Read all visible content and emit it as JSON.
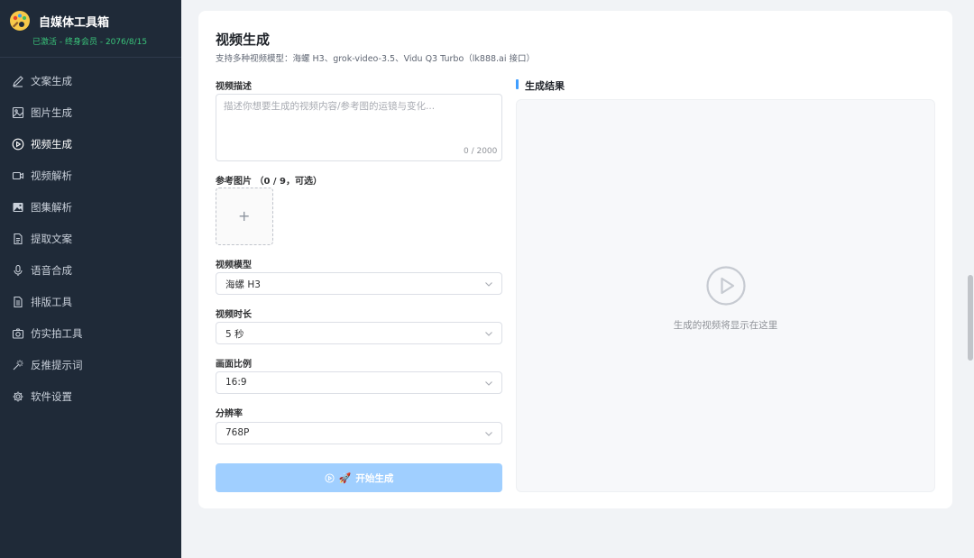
{
  "app": {
    "name": "自媒体工具箱",
    "status": "已激活 - 终身会员 - 2076/8/15"
  },
  "sidebar": {
    "items": [
      {
        "label": "文案生成",
        "icon": "edit-icon"
      },
      {
        "label": "图片生成",
        "icon": "image-icon"
      },
      {
        "label": "视频生成",
        "icon": "play-circle-icon",
        "active": true
      },
      {
        "label": "视频解析",
        "icon": "video-camera-icon"
      },
      {
        "label": "图集解析",
        "icon": "picture-icon"
      },
      {
        "label": "提取文案",
        "icon": "document-icon"
      },
      {
        "label": "语音合成",
        "icon": "microphone-icon"
      },
      {
        "label": "排版工具",
        "icon": "layout-document-icon"
      },
      {
        "label": "仿实拍工具",
        "icon": "camera-icon"
      },
      {
        "label": "反推提示词",
        "icon": "magic-wand-icon"
      },
      {
        "label": "软件设置",
        "icon": "gear-icon"
      }
    ]
  },
  "main": {
    "title": "视频生成",
    "subtitle": "支持多种视频模型：海螺 H3、grok-video-3.5、Vidu Q3 Turbo（lk888.ai 接口）",
    "description_label": "视频描述",
    "description_placeholder": "描述你想要生成的视频内容/参考图的运镜与变化...",
    "description_value": "",
    "description_counter": "0 / 2000",
    "reference_label": "参考图片 （0 / 9，可选）",
    "upload_plus": "+",
    "model_label": "视频模型",
    "model_value": "海螺 H3",
    "duration_label": "视频时长",
    "duration_value": "5 秒",
    "ratio_label": "画面比例",
    "ratio_value": "16:9",
    "resolution_label": "分辨率",
    "resolution_value": "768P",
    "generate_button": "开始生成",
    "generate_emoji": "🚀"
  },
  "result": {
    "title": "生成结果",
    "empty_text": "生成的视频将显示在这里"
  },
  "colors": {
    "sidebar_bg": "#1f2a38",
    "accent": "#409eff",
    "button_disabled": "#a0cfff",
    "status_green": "#39c47a"
  }
}
